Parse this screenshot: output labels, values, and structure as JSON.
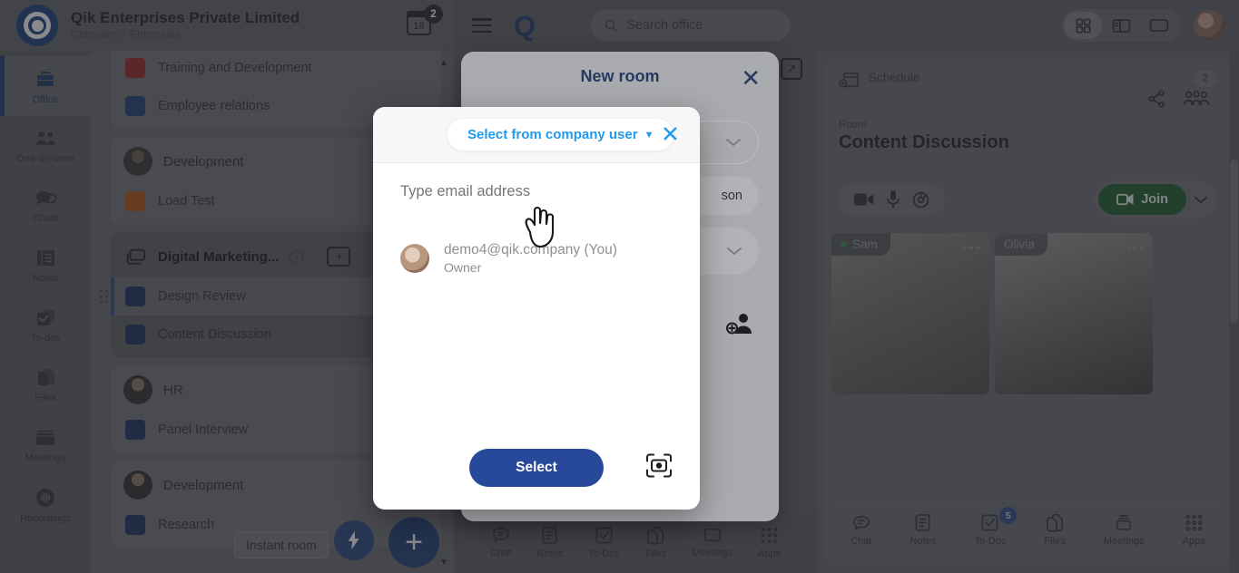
{
  "topbar": {
    "company_name": "Qik Enterprises Private Limited",
    "company_sub": "Company - Enterprise",
    "calendar_day": "16",
    "calendar_badge": "2",
    "brand_letter": "Q",
    "search_placeholder": "Search office",
    "icons": {
      "menu": "hamburger-icon",
      "search": "search-icon",
      "grid": "grid-layout-icon",
      "split": "split-layout-icon",
      "single": "single-layout-icon",
      "avatar": "user-avatar"
    }
  },
  "rail": {
    "items": [
      {
        "label": "Office",
        "icon": "briefcase-icon",
        "active": true
      },
      {
        "label": "One-on-ones",
        "icon": "people-icon",
        "active": false
      },
      {
        "label": "Chats",
        "icon": "chat-bubble-icon",
        "active": false
      },
      {
        "label": "Notes",
        "icon": "notes-icon",
        "active": false
      },
      {
        "label": "To-dos",
        "icon": "checkbox-icon",
        "active": false
      },
      {
        "label": "Files",
        "icon": "files-icon",
        "active": false
      },
      {
        "label": "Meetings",
        "icon": "meetings-icon",
        "active": false
      },
      {
        "label": "Recordings",
        "icon": "recordings-icon",
        "active": false
      }
    ]
  },
  "list_panel": {
    "groups": [
      {
        "title": null,
        "rows": [
          {
            "label": "Training and Development",
            "color": "#9e2326",
            "selected": false
          },
          {
            "label": "Employee relations",
            "color": "#1e3f75",
            "selected": false
          }
        ]
      },
      {
        "title": "Development",
        "avatar": "man-avatar",
        "rows": [
          {
            "label": "Load Test",
            "color": "#b2520f",
            "selected": false
          }
        ]
      },
      {
        "title": "Digital Marketing...",
        "icon": "folders-icon",
        "selected": true,
        "add_label": "+",
        "rows": [
          {
            "label": "Design Review",
            "color": "#17305c",
            "selected": true
          },
          {
            "label": "Content Discussion",
            "color": "#17305c",
            "selected": false
          }
        ]
      },
      {
        "title": "HR",
        "avatar": "woman-avatar",
        "rows": [
          {
            "label": "Panel Interview",
            "color": "#17305c",
            "selected": false
          }
        ]
      },
      {
        "title": "Development",
        "avatar": "woman-avatar",
        "rows": [
          {
            "label": "Research",
            "color": "#17305c",
            "selected": false
          }
        ]
      }
    ],
    "tooltip": "Instant room",
    "fab_bolt_icon": "lightning-bolt-icon",
    "fab_plus_label": "+"
  },
  "center_panel": {
    "expand_icon": "expand-arrow-icon",
    "toolbar": [
      {
        "label": "Chat",
        "icon": "chat-icon"
      },
      {
        "label": "Notes",
        "icon": "notes-icon"
      },
      {
        "label": "To-Dos",
        "icon": "todos-icon"
      },
      {
        "label": "Files",
        "icon": "files-icon"
      },
      {
        "label": "Meetings",
        "icon": "meetings-icon"
      },
      {
        "label": "Apps",
        "icon": "apps-grid-icon"
      }
    ]
  },
  "right_panel": {
    "schedule_label": "Schedule",
    "schedule_icon": "calendar-add-icon",
    "participants_badge": "2",
    "share_icon": "share-icon",
    "people_icon": "people-group-icon",
    "room_label": "Room",
    "room_title": "Content Discussion",
    "controls": {
      "camera_icon": "video-camera-icon",
      "mic_icon": "microphone-icon",
      "settings_icon": "gear-icon",
      "join_label": "Join",
      "join_icon": "video-icon",
      "chevron_icon": "chevron-down-icon"
    },
    "tiles": [
      {
        "name": "Sam",
        "online": true,
        "menu_icon": "more-dots-icon"
      },
      {
        "name": "Olivia",
        "online": false,
        "menu_icon": "more-dots-icon"
      }
    ],
    "toolbar": [
      {
        "label": "Chat",
        "icon": "chat-icon",
        "badge": null
      },
      {
        "label": "Notes",
        "icon": "notes-icon",
        "badge": null
      },
      {
        "label": "To-Dos",
        "icon": "todos-icon",
        "badge": "5"
      },
      {
        "label": "Files",
        "icon": "files-icon",
        "badge": null
      },
      {
        "label": "Meetings",
        "icon": "meetings-icon",
        "badge": null
      },
      {
        "label": "Apps",
        "icon": "apps-grid-icon",
        "badge": null
      }
    ]
  },
  "new_room_modal": {
    "title": "New room",
    "close_icon": "close-icon",
    "chevron_icon": "chevron-down-icon",
    "person_text": "son",
    "add_user_icon": "add-user-icon",
    "swatch_color": "#1e3f75"
  },
  "select_user_modal": {
    "dropdown_label": "Select from company user",
    "dropdown_caret": "▼",
    "close_icon": "close-icon",
    "email_placeholder": "Type email address",
    "email_value": "",
    "user": {
      "email": "demo4@qik.company",
      "you_tag": "(You)",
      "role": "Owner",
      "avatar": "user-avatar"
    },
    "select_button": "Select",
    "scan_icon": "scan-qr-icon"
  },
  "colors": {
    "accent_blue": "#1e3f75",
    "link_blue": "#1e9bf0",
    "join_green": "#1d5c2c",
    "select_button": "#28499a"
  }
}
